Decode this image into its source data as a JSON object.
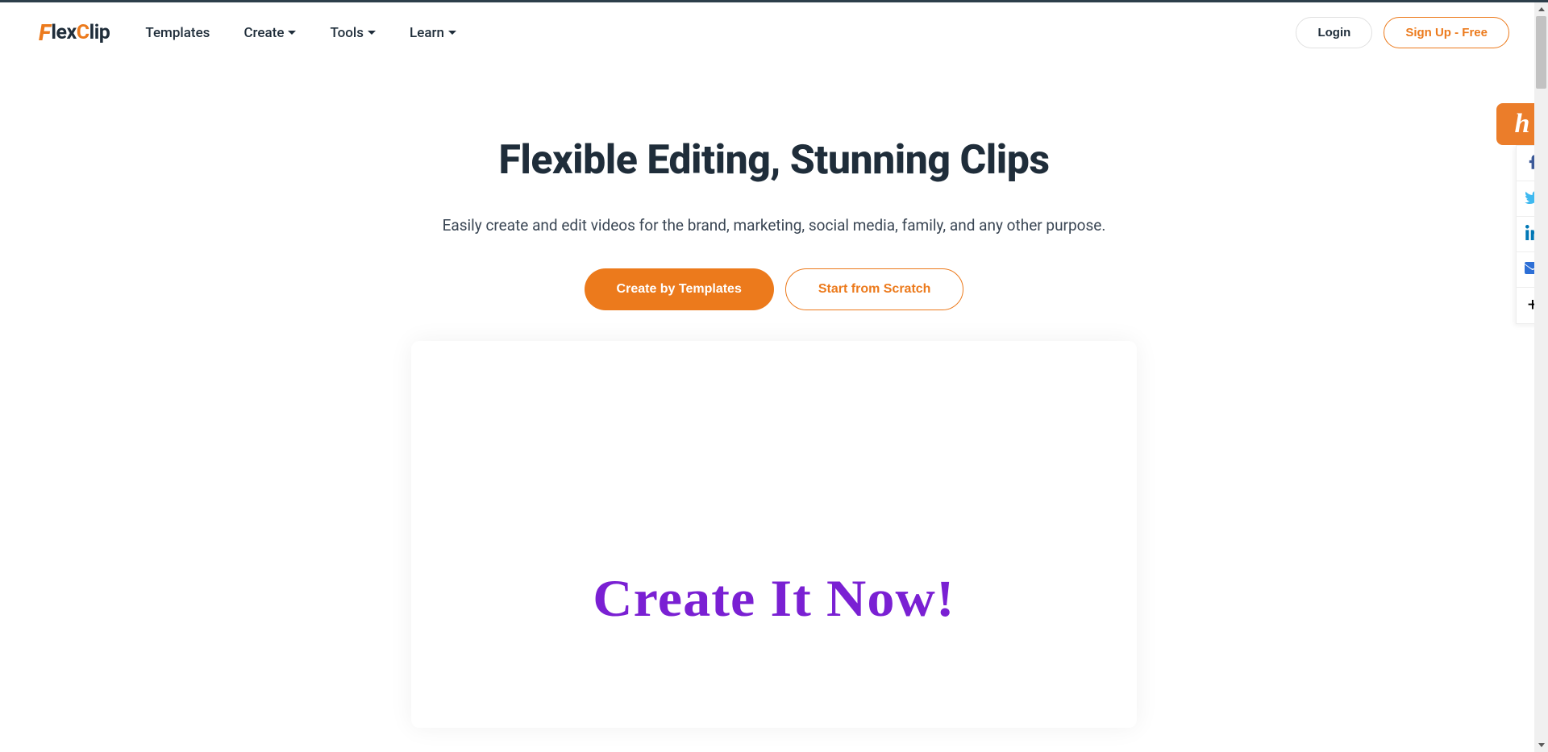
{
  "brand": {
    "name": "FlexClip"
  },
  "nav": {
    "templates": "Templates",
    "create": "Create",
    "tools": "Tools",
    "learn": "Learn"
  },
  "auth": {
    "login": "Login",
    "signup": "Sign Up - Free"
  },
  "hero": {
    "heading": "Flexible Editing, Stunning Clips",
    "subheading": "Easily create and edit videos for the brand, marketing, social media, family, and any other purpose.",
    "cta_primary": "Create by Templates",
    "cta_secondary": "Start from Scratch"
  },
  "preview": {
    "text": "Create It Now!"
  },
  "social": {
    "facebook": "facebook",
    "twitter": "twitter",
    "linkedin": "linkedin",
    "email": "email",
    "more": "more"
  }
}
